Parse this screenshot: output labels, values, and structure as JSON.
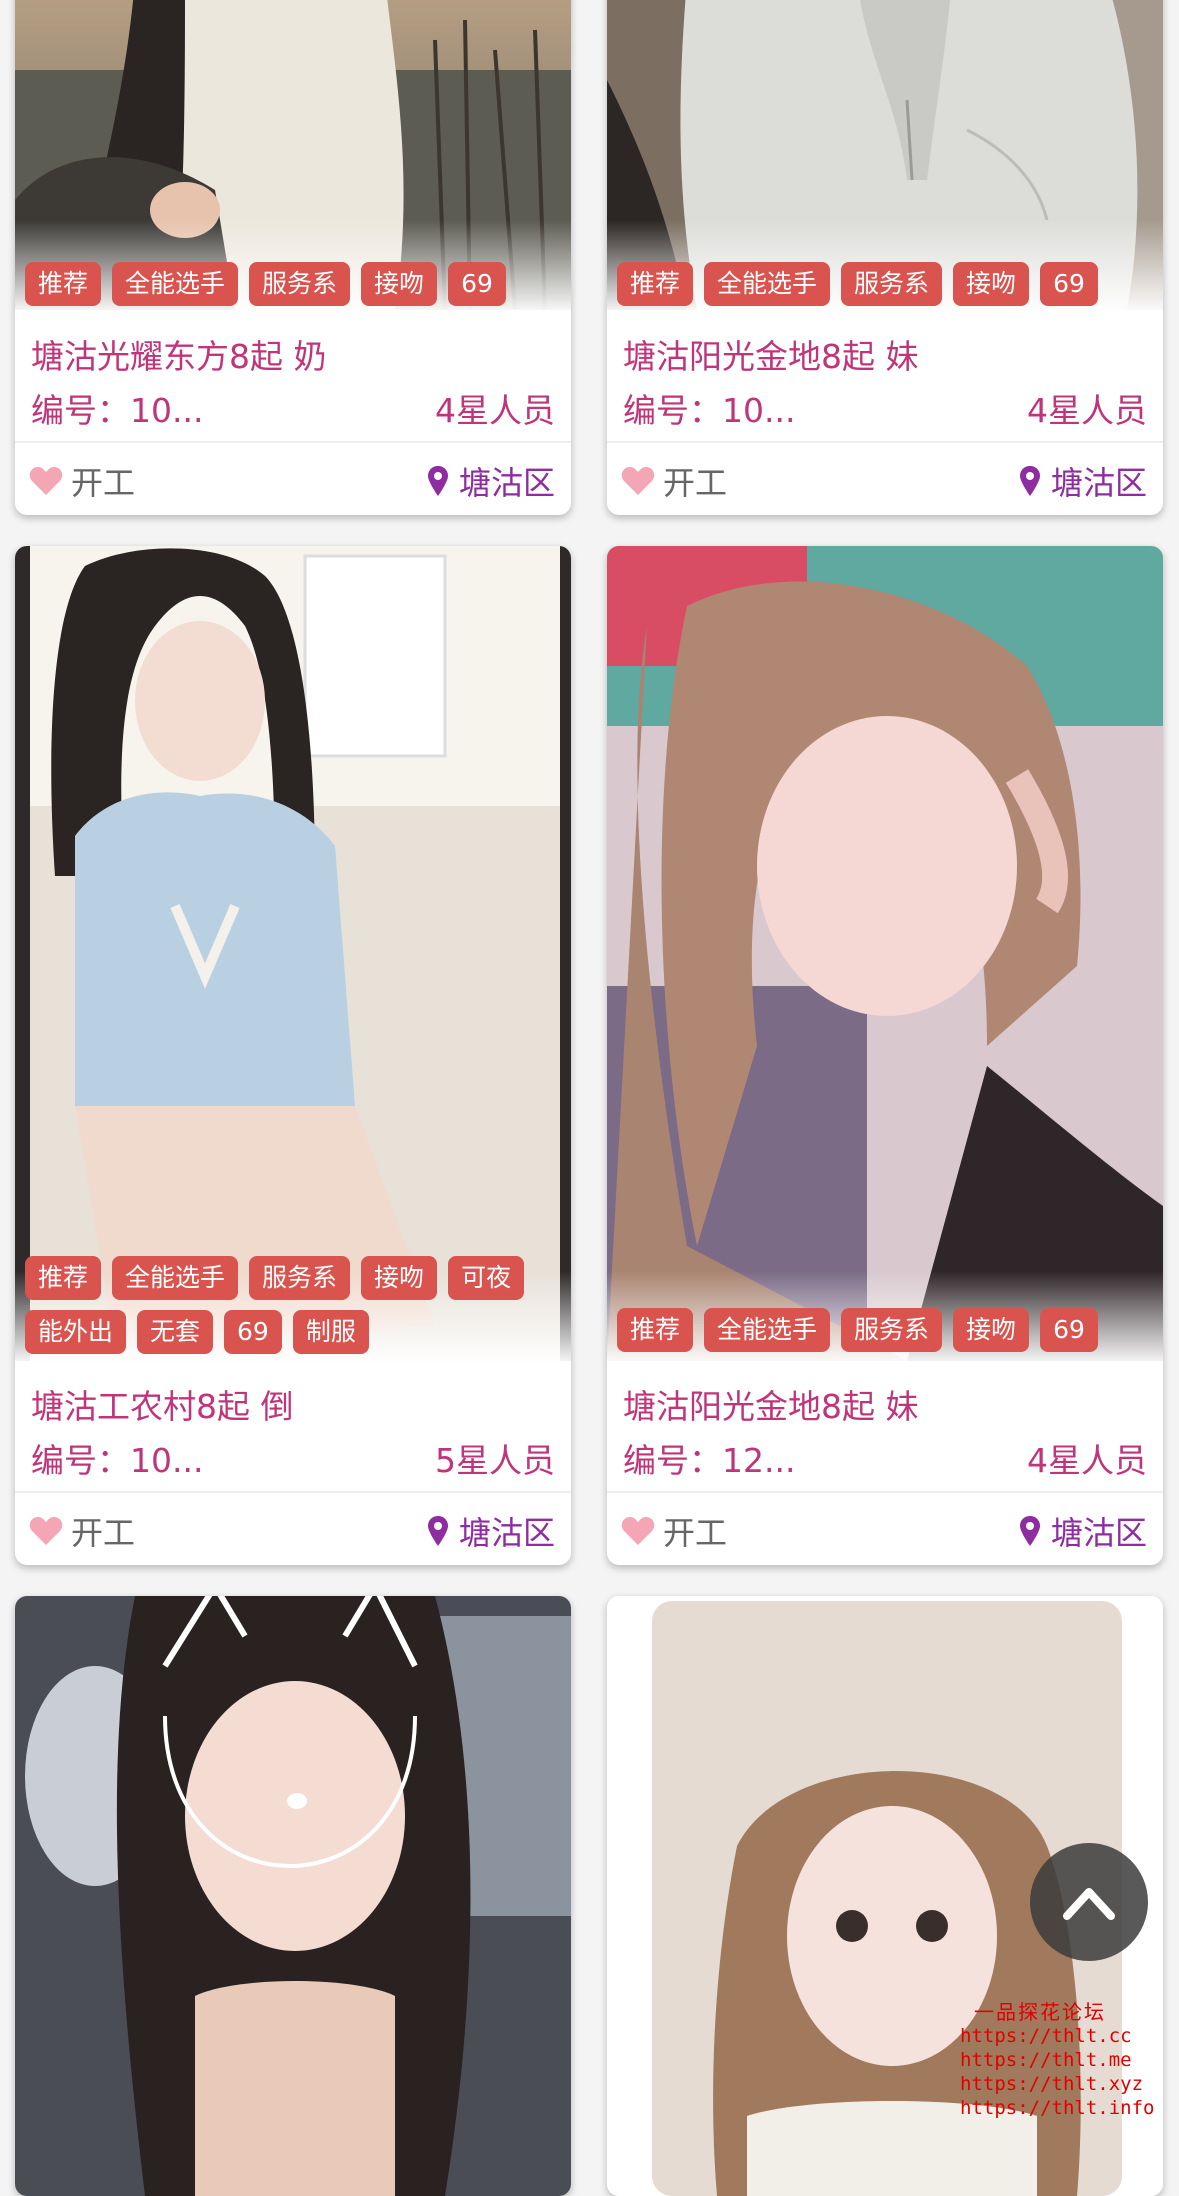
{
  "cards": [
    {
      "tags": [
        "推荐",
        "全能选手",
        "服务系",
        "接吻",
        "69"
      ],
      "title": "塘沽光耀东方8起 奶",
      "id_text": "编号：10...",
      "rank": "4星人员",
      "status": "开工",
      "district": "塘沽区",
      "photo_desc": "woman in white sweater by water"
    },
    {
      "tags": [
        "推荐",
        "全能选手",
        "服务系",
        "接吻",
        "69"
      ],
      "title": "塘沽阳光金地8起 妹",
      "id_text": "编号：10...",
      "rank": "4星人员",
      "status": "开工",
      "district": "塘沽区",
      "photo_desc": "woman in light grey zip top"
    },
    {
      "tags": [
        "推荐",
        "全能选手",
        "服务系",
        "接吻",
        "可夜",
        "能外出",
        "无套",
        "69",
        "制服"
      ],
      "title": "塘沽工农村8起 倒",
      "id_text": "编号：10...",
      "rank": "5星人员",
      "status": "开工",
      "district": "塘沽区",
      "photo_desc": "girl in light blue sailor uniform sitting"
    },
    {
      "tags": [
        "推荐",
        "全能选手",
        "服务系",
        "接吻",
        "69"
      ],
      "title": "塘沽阳光金地8起 妹",
      "id_text": "编号：12...",
      "rank": "4星人员",
      "status": "开工",
      "district": "塘沽区",
      "photo_desc": "long haired woman selfie"
    },
    {
      "tags": [],
      "title": "",
      "id_text": "",
      "rank": "",
      "status": "",
      "district": "",
      "photo_desc": "woman with cat ear filter in car"
    },
    {
      "tags": [],
      "title": "",
      "id_text": "",
      "rank": "",
      "status": "",
      "district": "",
      "photo_desc": "woman with light brown hair"
    }
  ],
  "colors": {
    "tag_bg": "#d9534f",
    "title": "#c0357a",
    "district": "#8e2da0",
    "heart": "#f4a6b4"
  },
  "icons": {
    "status": "heart-icon",
    "district": "map-pin-icon",
    "scroll_top": "chevron-up-icon"
  },
  "watermark": {
    "title": "一品探花论坛",
    "links": [
      "https://thlt.cc",
      "https://thlt.me",
      "https://thlt.xyz",
      "https://thlt.info"
    ]
  }
}
